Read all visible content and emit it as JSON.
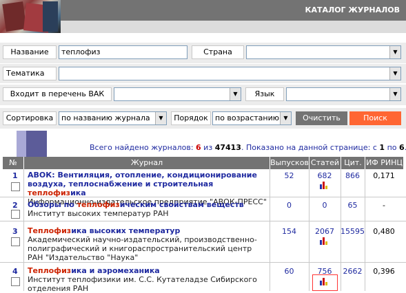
{
  "header": {
    "title": "КАТАЛОГ ЖУРНАЛОВ",
    "bar_color": "#737373"
  },
  "search": {
    "name_label": "Название",
    "name_value": "теплофиз",
    "country_label": "Страна",
    "country_value": "",
    "topic_label": "Тематика",
    "topic_value": "",
    "vak_label": "Входит в перечень ВАК",
    "vak_value": "",
    "language_label": "Язык",
    "language_value": "",
    "sort_label": "Сортировка",
    "sort_value": "по названию журнала",
    "order_label": "Порядок",
    "order_value": "по возрастанию",
    "clear_label": "Очистить",
    "search_label": "Поиск",
    "search_color": "#ff6633"
  },
  "summary": {
    "found_prefix": "Всего найдено журналов: ",
    "found_count": "6",
    "of_text": " из ",
    "total": "47413",
    "shown_prefix": ".   Показано на данной странице: с ",
    "from": "1",
    "to_text": " по ",
    "to": "6",
    "end": "."
  },
  "table": {
    "columns": [
      "№",
      "Журнал",
      "Выпусков",
      "Статей",
      "Цит.",
      "ИФ РИНЦ"
    ],
    "rows": [
      {
        "num": "1",
        "title_pre": "АВОК: Вентиляция, отопление, кондиционирование воздуха, теплоснабжение и строительная ",
        "title_hl": "теплофиз",
        "title_post": "ика",
        "publisher": "Информационно-издательское предприятие \"АВОК-ПРЕСС\"",
        "issues": "52",
        "articles": "682",
        "citations": "866",
        "impact": "0,171",
        "chart": true
      },
      {
        "num": "2",
        "title_pre": "Обзоры по ",
        "title_hl": "теплофиз",
        "title_post": "ическим свойствам веществ",
        "publisher": "Институт высоких температур РАН",
        "issues": "0",
        "articles": "0",
        "citations": "65",
        "impact": "-",
        "chart": false
      },
      {
        "num": "3",
        "title_pre": "",
        "title_hl": "Теплофиз",
        "title_post": "ика высоких температур",
        "publisher": "Академический научно-издательский, производственно-полиграфический и книгораспространительский центр РАН \"Издательство \"Наука\"",
        "issues": "154",
        "articles": "2067",
        "citations": "15595",
        "impact": "0,480",
        "chart": true
      },
      {
        "num": "4",
        "title_pre": "",
        "title_hl": "Теплофиз",
        "title_post": "ика и аэромеханика",
        "publisher": "Институт теплофизики им. С.С. Кутателадзе Сибирского отделения РАН",
        "issues": "60",
        "articles": "756",
        "citations": "2662",
        "impact": "0,396",
        "chart": true
      }
    ]
  },
  "icons": {
    "dropdown": "chevron-down-icon",
    "stats": "bar-chart-icon",
    "logo": "journals-logo"
  }
}
